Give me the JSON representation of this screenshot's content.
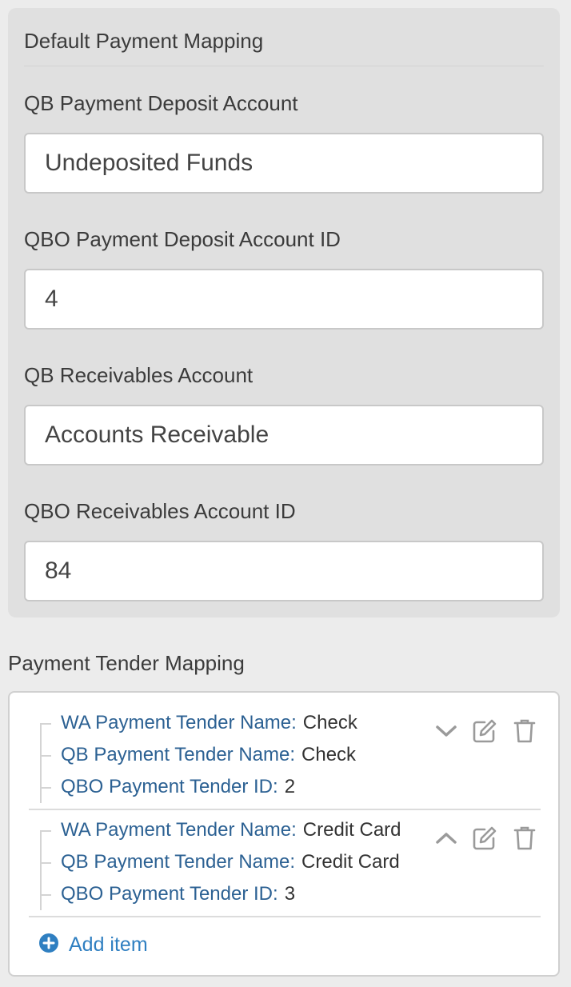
{
  "default_mapping": {
    "title": "Default Payment Mapping",
    "fields": [
      {
        "label": "QB Payment Deposit Account",
        "value": "Undeposited Funds"
      },
      {
        "label": "QBO Payment Deposit Account ID",
        "value": "4"
      },
      {
        "label": "QB Receivables Account",
        "value": "Accounts Receivable"
      },
      {
        "label": "QBO Receivables Account ID",
        "value": "84"
      }
    ]
  },
  "tender_mapping": {
    "title": "Payment Tender Mapping",
    "items": [
      {
        "wa_label": "WA Payment Tender Name:",
        "wa_value": "Check",
        "qb_label": "QB Payment Tender Name:",
        "qb_value": "Check",
        "qbo_label": "QBO Payment Tender ID:",
        "qbo_value": "2",
        "toggle_icon": "chevron-down-icon"
      },
      {
        "wa_label": "WA Payment Tender Name:",
        "wa_value": "Credit Card",
        "qb_label": "QB Payment Tender Name:",
        "qb_value": "Credit Card",
        "qbo_label": "QBO Payment Tender ID:",
        "qbo_value": "3",
        "toggle_icon": "chevron-up-icon"
      }
    ],
    "add_label": "Add item"
  },
  "colors": {
    "label_blue": "#2c6193",
    "link_blue": "#2f7fc1",
    "icon_gray": "#9a9a9a"
  }
}
